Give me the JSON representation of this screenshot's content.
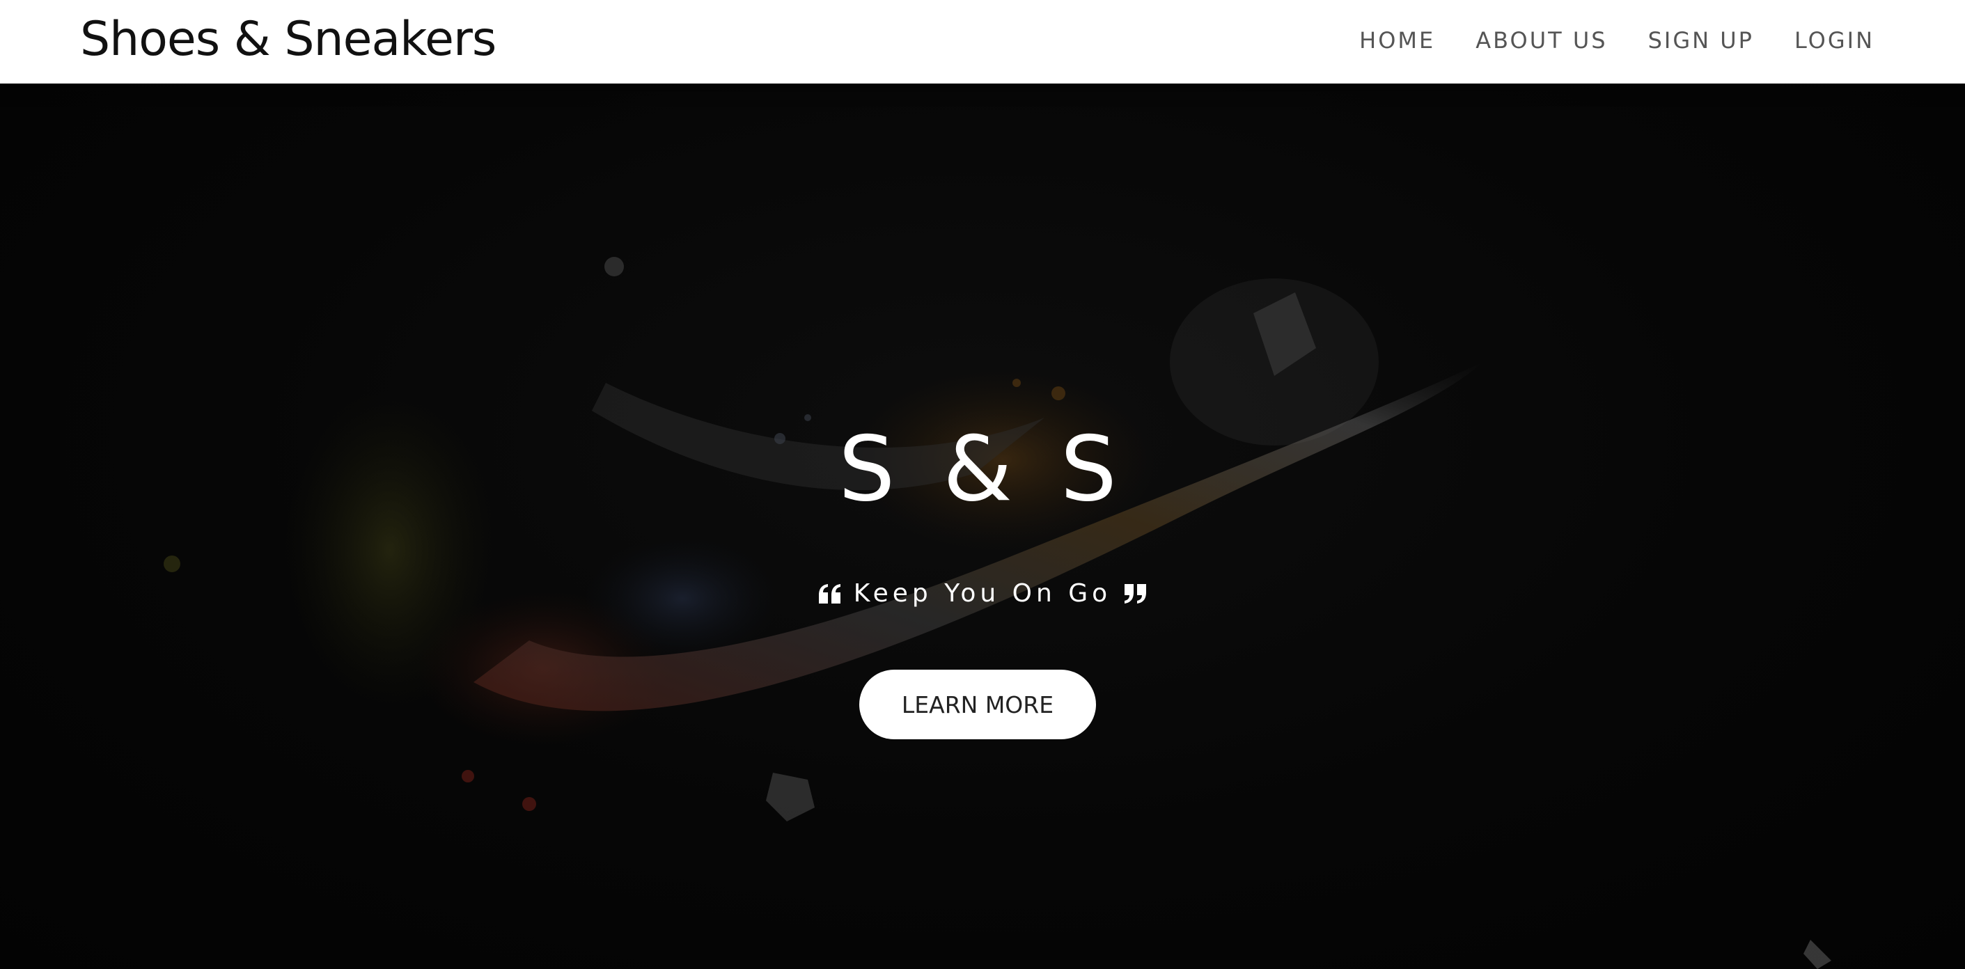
{
  "navbar": {
    "brand": "Shoes & Sneakers",
    "links": [
      "HOME",
      "ABOUT US",
      "SIGN UP",
      "LOGIN"
    ]
  },
  "hero": {
    "title": "S & S",
    "tagline": "Keep You On Go",
    "cta_label": "LEARN MORE",
    "open_quote_icon": "quote-left-icon",
    "close_quote_icon": "quote-right-icon",
    "background_color": "#050505"
  },
  "colors": {
    "navbar_bg": "#ffffff",
    "brand_text": "#111111",
    "nav_link_text": "#555555",
    "hero_text": "#ffffff",
    "cta_bg": "#ffffff",
    "cta_text": "#222222"
  }
}
